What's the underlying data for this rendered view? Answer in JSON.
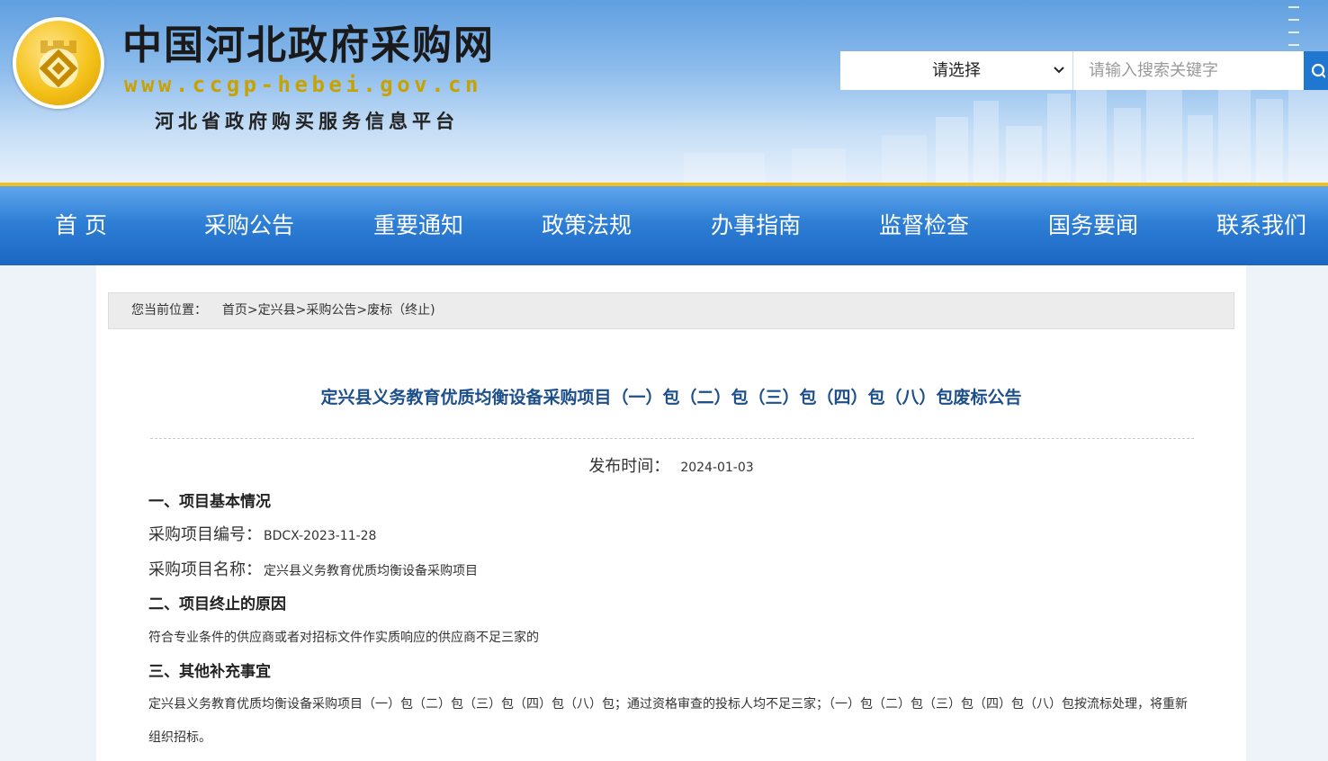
{
  "header": {
    "site_title": "中国河北政府采购网",
    "site_url": "www.ccgp-hebei.gov.cn",
    "site_subtitle": "河北省政府购买服务信息平台",
    "logo_icon": "ccgp-hebei-logo-icon",
    "search": {
      "select_value": "请选择",
      "input_placeholder": "请输入搜索关键字",
      "button_icon": "search-icon"
    }
  },
  "nav": {
    "items": [
      {
        "label": "首 页"
      },
      {
        "label": "采购公告"
      },
      {
        "label": "重要通知"
      },
      {
        "label": "政策法规"
      },
      {
        "label": "办事指南"
      },
      {
        "label": "监督检查"
      },
      {
        "label": "国务要闻"
      },
      {
        "label": "联系我们"
      }
    ]
  },
  "breadcrumb": {
    "prefix": "您当前位置：",
    "items": [
      {
        "label": "首页"
      },
      {
        "label": "定兴县"
      },
      {
        "label": "采购公告"
      },
      {
        "label": "废标（终止)"
      }
    ],
    "separator": ">"
  },
  "article": {
    "title": "定兴县义务教育优质均衡设备采购项目（一）包（二）包（三）包（四）包（八）包废标公告",
    "publish_label": "发布时间：",
    "publish_date": "2024-01-03",
    "sections": [
      {
        "heading": "一、项目基本情况"
      },
      {
        "heading": "二、项目终止的原因"
      },
      {
        "heading": "三、其他补充事宜"
      }
    ],
    "fields": [
      {
        "label": "采购项目编号：",
        "value": "BDCX-2023-11-28"
      },
      {
        "label": "采购项目名称：",
        "value": "定兴县义务教育优质均衡设备采购项目"
      }
    ],
    "reason": "符合专业条件的供应商或者对招标文件作实质响应的供应商不足三家的",
    "supplement": "定兴县义务教育优质均衡设备采购项目（一）包（二）包（三）包（四）包（八）包；通过资格审查的投标人均不足三家；（一）包（二）包（三）包（四）包（八）包按流标处理，将重新组织招标。"
  },
  "colors": {
    "nav_blue": "#2f7fd6",
    "nav_top_border": "#f2c21c",
    "title_blue": "#1d4f8a",
    "search_button": "#1f77d0",
    "logo_gold": "#f4c21a"
  }
}
